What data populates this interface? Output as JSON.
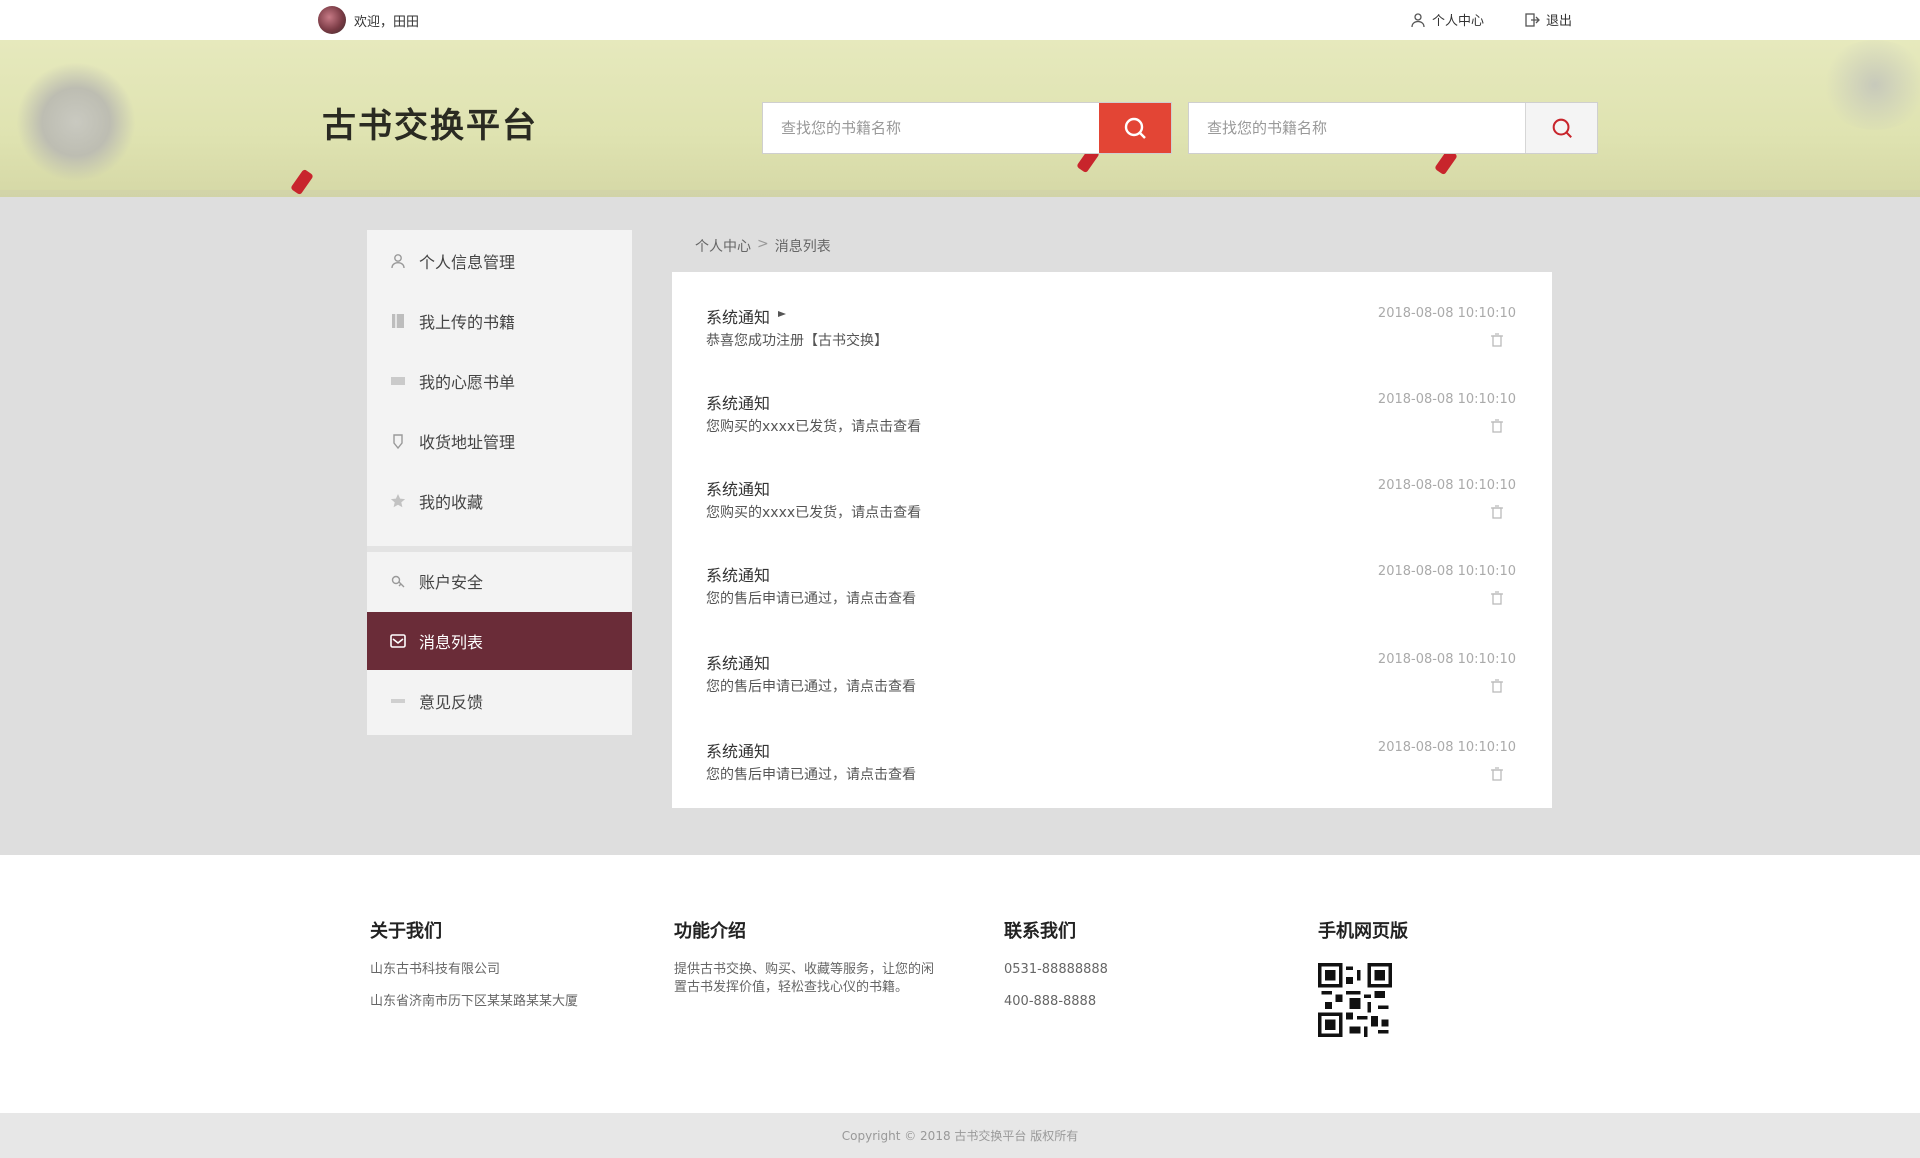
{
  "topbar": {
    "welcome": "欢迎，田田",
    "user_center": "个人中心",
    "logout": "退出"
  },
  "banner": {
    "logo_text": "古书交换平台",
    "search1_placeholder": "查找您的书籍名称",
    "search2_placeholder": "查找您的书籍名称",
    "accent_color": "#e34535"
  },
  "sidebar": {
    "items": [
      {
        "label": "个人信息管理",
        "icon": "user-icon"
      },
      {
        "label": "我上传的书籍",
        "icon": "book-icon"
      },
      {
        "label": "我的心愿书单",
        "icon": "list-icon"
      },
      {
        "label": "收货地址管理",
        "icon": "location-icon"
      },
      {
        "label": "我的收藏",
        "icon": "star-icon"
      },
      {
        "label": "账户安全",
        "icon": "lock-icon"
      },
      {
        "label": "消息列表",
        "icon": "mail-icon",
        "active": true
      },
      {
        "label": "意见反馈",
        "icon": "feedback-icon"
      }
    ],
    "active_color": "#6a2c38"
  },
  "breadcrumb": {
    "home": "个人中心",
    "current": "消息列表"
  },
  "messages": [
    {
      "title": "系统通知",
      "body": "恭喜您成功注册【古书交换】",
      "time": "2018-08-08  10:10:10",
      "flag": true
    },
    {
      "title": "系统通知",
      "body": "您购买的xxxx已发货，请点击查看",
      "time": "2018-08-08  10:10:10"
    },
    {
      "title": "系统通知",
      "body": "您购买的xxxx已发货，请点击查看",
      "time": "2018-08-08  10:10:10"
    },
    {
      "title": "系统通知",
      "body": "您的售后申请已通过，请点击查看",
      "time": "2018-08-08  10:10:10"
    },
    {
      "title": "系统通知",
      "body": "您的售后申请已通过，请点击查看",
      "time": "2018-08-08  10:10:10"
    },
    {
      "title": "系统通知",
      "body": "您的售后申请已通过，请点击查看",
      "time": "2018-08-08  10:10:10"
    }
  ],
  "footer": {
    "about_title": "关于我们",
    "about_lines": [
      "山东古书科技有限公司",
      "山东省济南市历下区某某路某某大厦"
    ],
    "features_title": "功能介绍",
    "features_text": "提供古书交换、购买、收藏等服务，让您的闲置古书发挥价值，轻松查找心仪的书籍。",
    "contact_title": "联系我们",
    "contact_lines": [
      "0531-88888888",
      "400-888-8888"
    ],
    "mobile_title": "手机网页版",
    "copyright": "Copyright © 2018 古书交换平台 版权所有"
  }
}
